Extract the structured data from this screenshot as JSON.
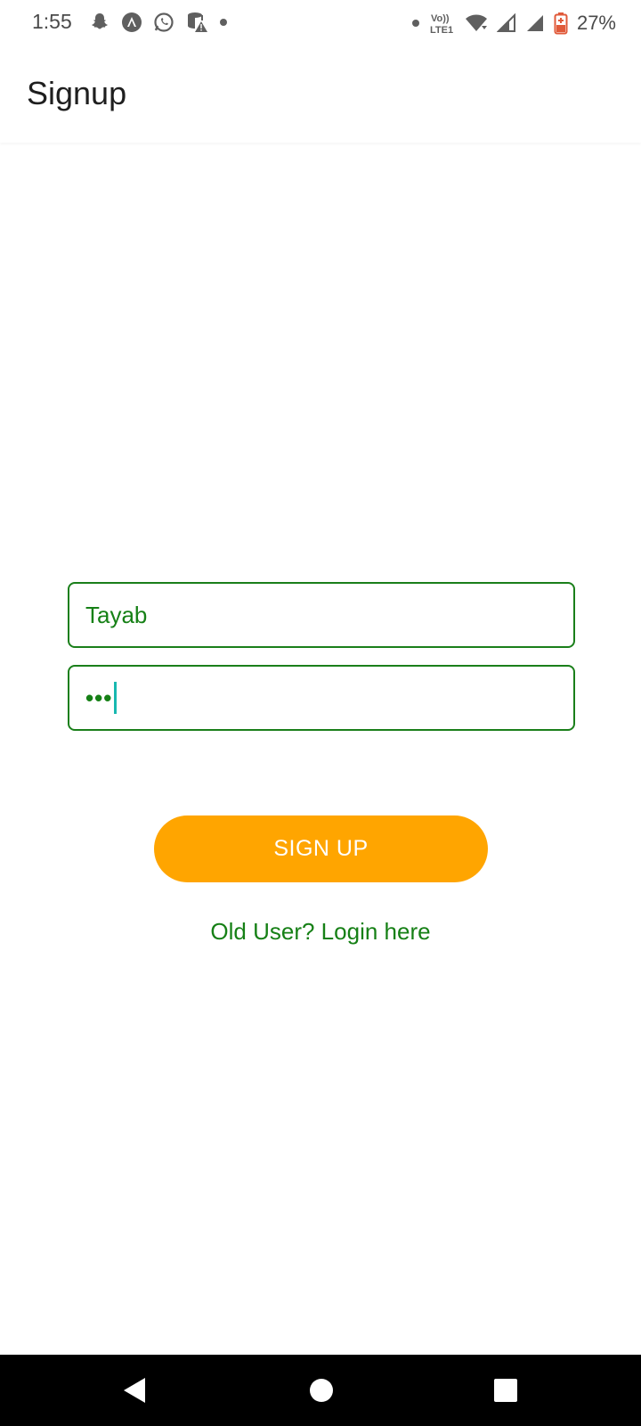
{
  "status_bar": {
    "time": "1:55",
    "battery_percent": "27%",
    "left_icons": [
      "snapchat-icon",
      "navigation-app-icon",
      "whatsapp-icon",
      "database-warning-icon",
      "dot-icon"
    ],
    "right_icons": [
      "dot-icon",
      "volte-lte-icon",
      "wifi-icon",
      "signal-icon",
      "signal-icon",
      "battery-icon"
    ],
    "volte_label": "Vo)) LTE1"
  },
  "app_bar": {
    "title": "Signup"
  },
  "form": {
    "username_value": "Tayab",
    "password_masked": "•••",
    "signup_label": "SIGN UP",
    "login_link": "Old User? Login here"
  },
  "colors": {
    "accent_green": "#168016",
    "button_orange": "#ffa500",
    "cursor_teal": "#18b8b0"
  },
  "nav_bar": {
    "icons": [
      "back-icon",
      "home-icon",
      "recents-icon"
    ]
  }
}
